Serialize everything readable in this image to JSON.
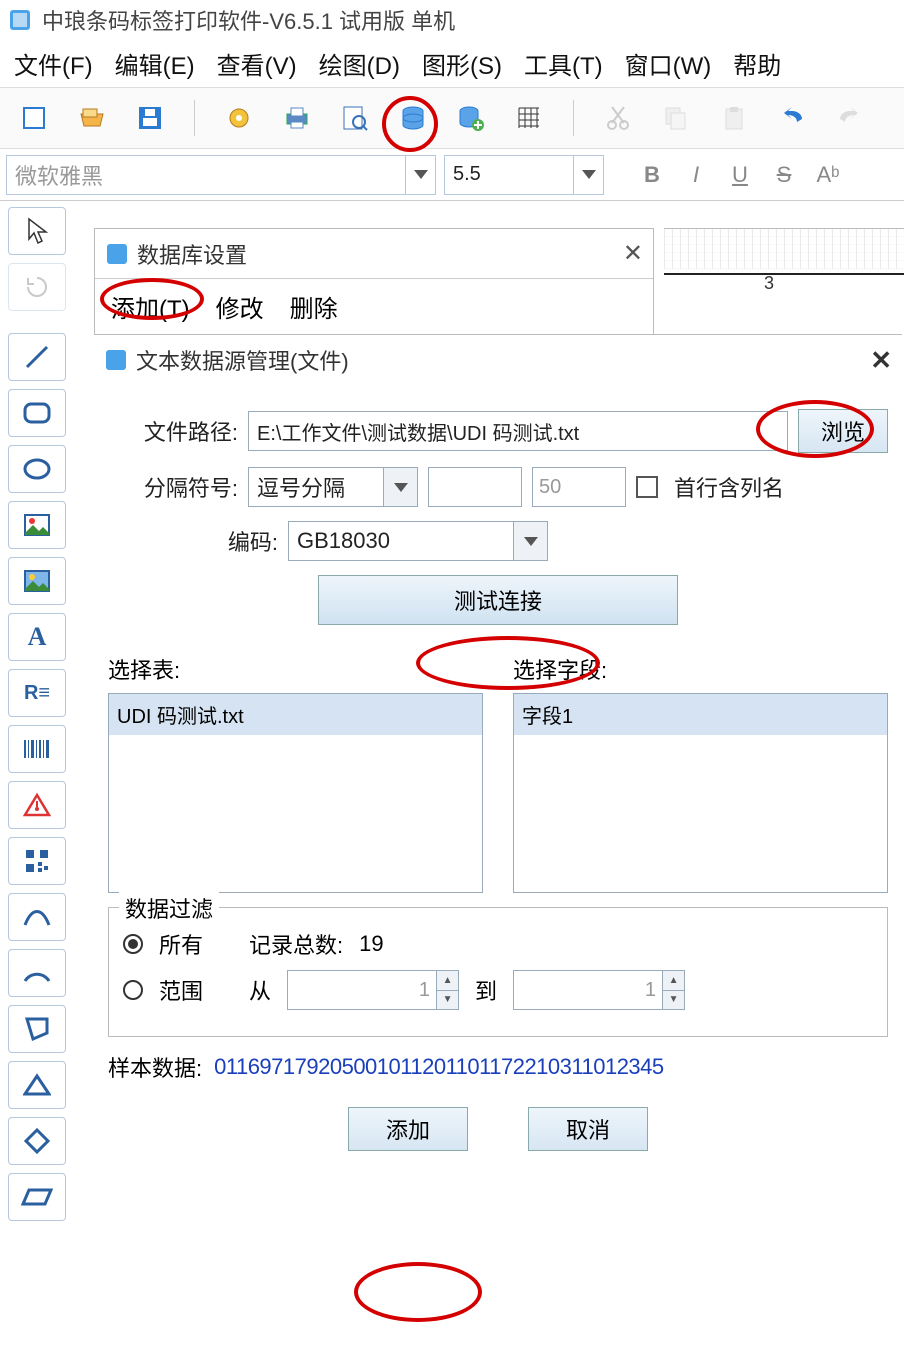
{
  "app": {
    "title": "中琅条码标签打印软件-V6.5.1 试用版 单机"
  },
  "menu": {
    "file": "文件(F)",
    "edit": "编辑(E)",
    "view": "查看(V)",
    "draw": "绘图(D)",
    "shape": "图形(S)",
    "tool": "工具(T)",
    "window": "窗口(W)",
    "help": "帮助"
  },
  "fontrow": {
    "font_placeholder": "微软雅黑",
    "size": "5.5",
    "bold": "B",
    "italic": "I",
    "underline": "U",
    "strike": "S",
    "sup": "Aᵇ"
  },
  "ruler": {
    "mark": "3"
  },
  "dlg_db": {
    "title": "数据库设置",
    "add": "添加(T)",
    "modify": "修改",
    "delete": "删除"
  },
  "dlg_ds": {
    "title": "文本数据源管理(文件)",
    "file_path_label": "文件路径:",
    "file_path_value": "E:\\工作文件\\测试数据\\UDI 码测试.txt",
    "browse": "浏览",
    "sep_label": "分隔符号:",
    "sep_value": "逗号分隔",
    "sep_extra": "50",
    "first_row": "首行含列名",
    "enc_label": "编码:",
    "enc_value": "GB18030",
    "test": "测试连接",
    "select_table": "选择表:",
    "select_field": "选择字段:",
    "table_item": "UDI 码测试.txt",
    "field_item": "字段1",
    "filter_legend": "数据过滤",
    "all": "所有",
    "total_label": "记录总数:",
    "total": "19",
    "range": "范围",
    "from": "从",
    "to": "到",
    "from_val": "1",
    "to_val": "1",
    "sample_label": "样本数据:",
    "sample_value": "011697179205001011201101172210311012345",
    "ok": "添加",
    "cancel": "取消"
  }
}
